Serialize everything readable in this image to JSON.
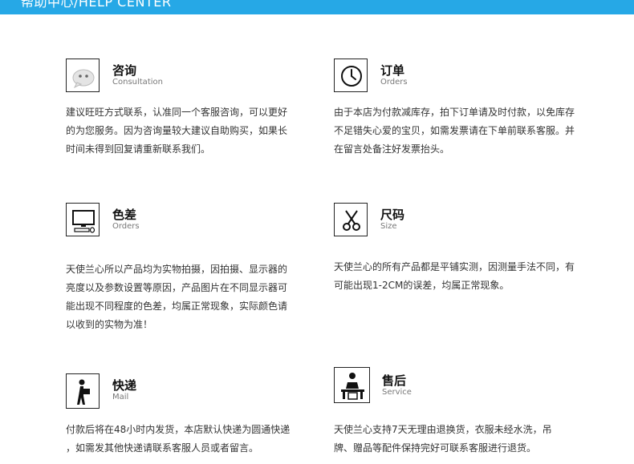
{
  "header": {
    "title": "帮助中心/HELP  CENTER"
  },
  "sections": [
    {
      "title": "咨询",
      "subtitle": "Consultation",
      "icon": "chat-bubble-icon",
      "lines": [
        "建议旺旺方式联系，认准同一个客服咨询，可以更好",
        "的为您服务。因为咨询量较大建议自助购买，如果长",
        "时间未得到回复请重新联系我们。"
      ]
    },
    {
      "title": "订单",
      "subtitle": "Orders",
      "icon": "clock-icon",
      "lines": [
        "由于本店为付款减库存，拍下订单请及时付款，以免库存",
        "不足错失心爱的宝贝，如需发票请在下单前联系客服。并",
        "在留言处备注好发票抬头。"
      ]
    },
    {
      "title": "色差",
      "subtitle": "Orders",
      "icon": "computer-monitor-icon",
      "lines": [
        "天使兰心所以产品均为实物拍摄，因拍摄、显示器的",
        "亮度以及参数设置等原因，产品图片在不同显示器可",
        "能出现不同程度的色差，均属正常现象，实际颜色请",
        "以收到的实物为准！"
      ]
    },
    {
      "title": "尺码",
      "subtitle": "Size",
      "icon": "scissors-icon",
      "lines": [
        "天使兰心的所有产品都是平铺实测，因测量手法不同，有",
        "可能出现1-2CM的误差，均属正常现象。"
      ]
    },
    {
      "title": "快递",
      "subtitle": "Mail",
      "icon": "courier-icon",
      "lines": [
        "付款后将在48小时内发货，本店默认快递为圆通快递",
        "，如需发其他快递请联系客服人员或者留言。"
      ]
    },
    {
      "title": "售后",
      "subtitle": "Service",
      "icon": "service-desk-icon",
      "lines": [
        "天使兰心支持7天无理由退换货，衣服未经水洗，吊",
        "牌、赠品等配件保持完好可联系客服进行退货。"
      ]
    }
  ]
}
